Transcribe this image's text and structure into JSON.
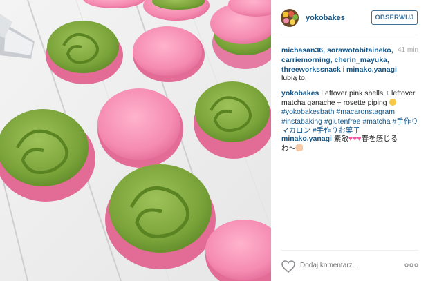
{
  "post": {
    "username": "yokobakes",
    "follow_label": "OBSERWUJ",
    "time_ago": "41 min",
    "likers": "michasan36, sorawotobitaineko, carriemorning, cherin_mayuka, threeworkssnack",
    "likers_connector": "i",
    "likers_last": "minako.yanagi",
    "likes_suffix": "lubią to.",
    "caption_user": "yokobakes",
    "caption_text": "Leftover pink shells + leftover matcha ganache + rosette piping",
    "caption_tags_1": "#yokobakesbath #macaronstagram",
    "caption_tags_2": "#instabaking #glutenfree #matcha #手作り",
    "caption_tags_3": "マカロン #手作りお菓子",
    "comment_user": "minako.yanagi",
    "comment_text_1": "素敵",
    "comment_text_2": "春を感じる",
    "comment_text_3": "わ〜",
    "comment_placeholder": "Dodaj komentarz...",
    "icons": {
      "like": "heart-outline-icon",
      "more": "ellipsis-icon",
      "caption_emoji": "smiling-face-emoji",
      "comment_emoji": "pink-heart-emoji",
      "comment_hand": "clapping-hands-emoji"
    },
    "colors": {
      "link": "#125688",
      "follow": "#3f729b",
      "muted": "#a5a7aa",
      "pink_shell": "#f28bb0",
      "matcha": "#7da43a"
    }
  }
}
